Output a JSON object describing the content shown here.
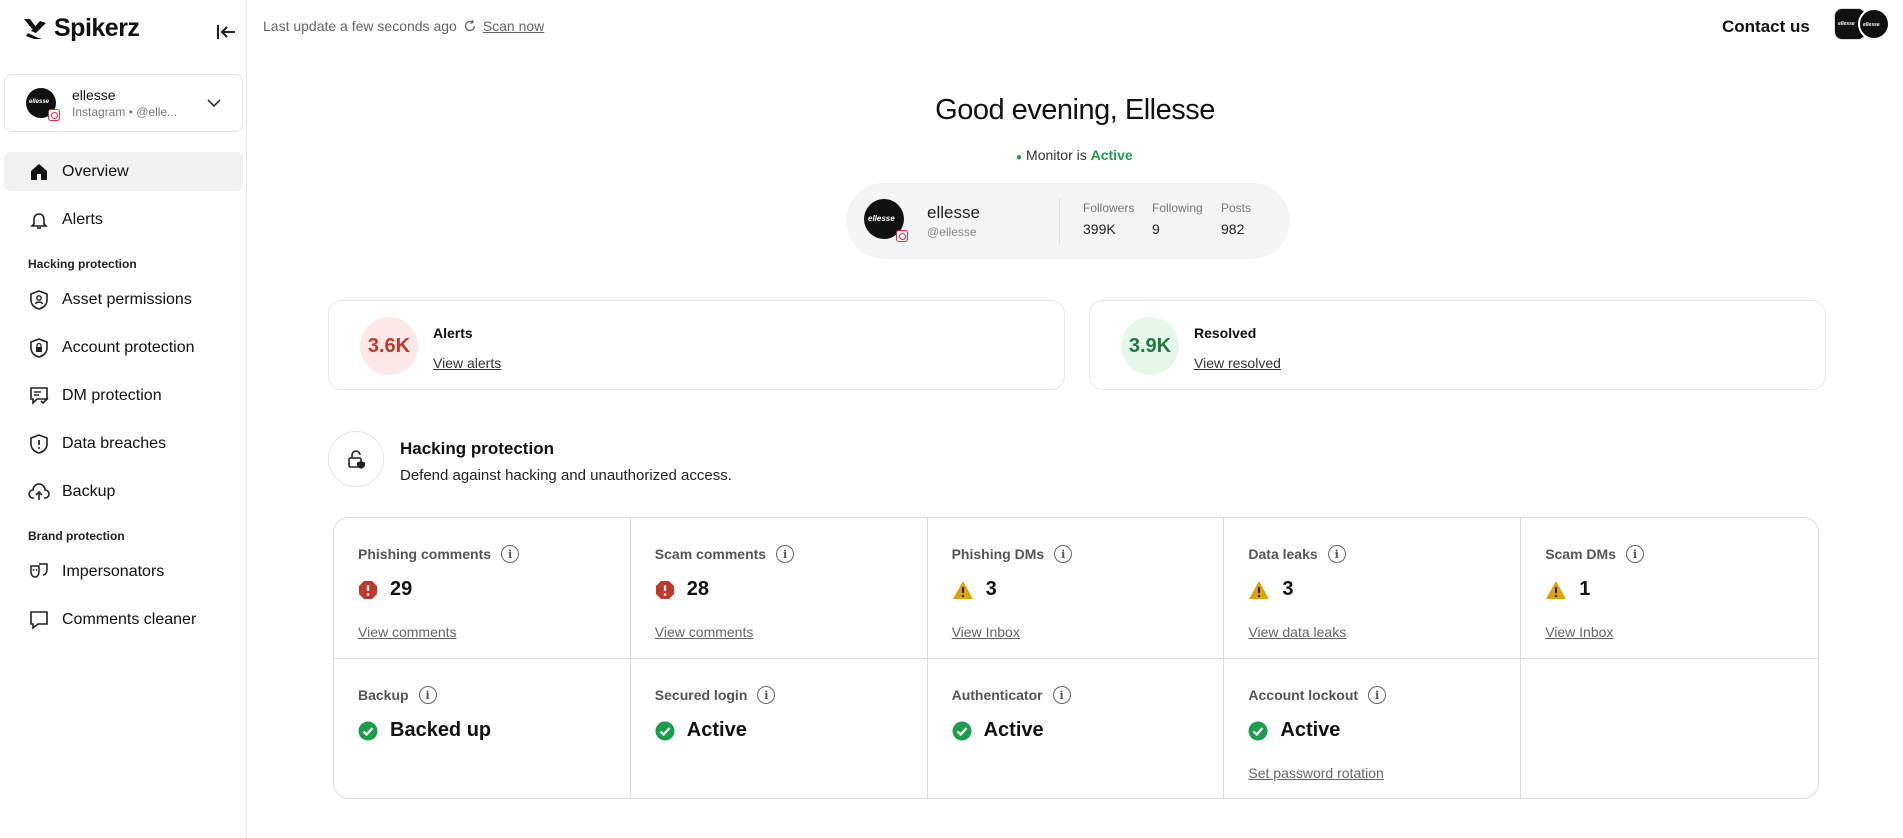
{
  "brand": {
    "name": "Spikerz"
  },
  "account": {
    "name": "ellesse",
    "sub": "Instagram • @elle...",
    "avatar_text": "ellesse"
  },
  "nav": {
    "overview": "Overview",
    "alerts": "Alerts",
    "section_hacking": "Hacking protection",
    "asset_permissions": "Asset permissions",
    "account_protection": "Account protection",
    "dm_protection": "DM protection",
    "data_breaches": "Data breaches",
    "backup": "Backup",
    "section_brand": "Brand protection",
    "impersonators": "Impersonators",
    "comments_cleaner": "Comments cleaner"
  },
  "topbar": {
    "last_update": "Last update a few seconds ago",
    "scan_now": "Scan now",
    "contact": "Contact us"
  },
  "greeting": "Good evening, Ellesse",
  "monitor": {
    "prefix": "Monitor is",
    "status": "Active"
  },
  "profile": {
    "name": "ellesse",
    "handle": "@ellesse",
    "avatar_text": "ellesse",
    "followers_label": "Followers",
    "followers": "399K",
    "following_label": "Following",
    "following": "9",
    "posts_label": "Posts",
    "posts": "982"
  },
  "summary": {
    "alerts": {
      "value": "3.6K",
      "title": "Alerts",
      "link": "View alerts"
    },
    "resolved": {
      "value": "3.9K",
      "title": "Resolved",
      "link": "View resolved"
    }
  },
  "section": {
    "title": "Hacking protection",
    "desc": "Defend against hacking and unauthorized access."
  },
  "cards": [
    {
      "title": "Phishing comments",
      "value": "29",
      "status": "error",
      "link": "View comments"
    },
    {
      "title": "Scam comments",
      "value": "28",
      "status": "error",
      "link": "View comments"
    },
    {
      "title": "Phishing DMs",
      "value": "3",
      "status": "warning",
      "link": "View Inbox"
    },
    {
      "title": "Data leaks",
      "value": "3",
      "status": "warning",
      "link": "View data leaks"
    },
    {
      "title": "Scam DMs",
      "value": "1",
      "status": "warning",
      "link": "View Inbox"
    },
    {
      "title": "Backup",
      "value": "Backed up",
      "status": "ok",
      "link": ""
    },
    {
      "title": "Secured login",
      "value": "Active",
      "status": "ok",
      "link": ""
    },
    {
      "title": "Authenticator",
      "value": "Active",
      "status": "ok",
      "link": ""
    },
    {
      "title": "Account lockout",
      "value": "Active",
      "status": "ok",
      "link": "Set password rotation"
    }
  ],
  "colors": {
    "active_green": "#1a9e4b",
    "alert_red": "#c0392b",
    "alert_bg": "#fde8e8",
    "resolved_green": "#1f7a3f",
    "resolved_bg": "#e4f7ea",
    "warning": "#e0a200"
  }
}
